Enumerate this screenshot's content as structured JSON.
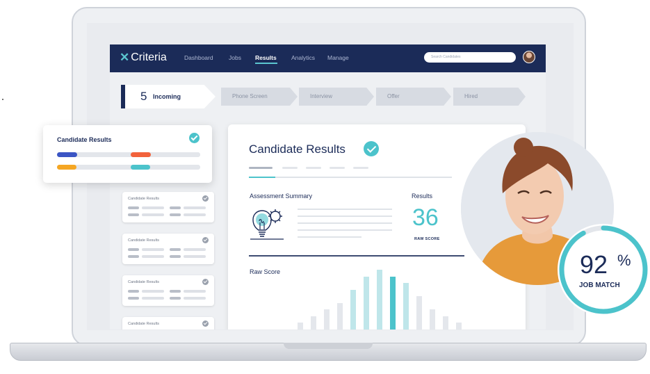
{
  "nav": {
    "logo": "Criteria",
    "items": [
      "Dashboard",
      "Jobs",
      "Results",
      "Analytics",
      "Manage"
    ],
    "active_index": 2,
    "search_placeholder": "Search Candidates"
  },
  "pipeline": {
    "current": {
      "count": "5",
      "label": "Incoming"
    },
    "stages": [
      "Phone Screen",
      "Interview",
      "Offer",
      "Hired"
    ]
  },
  "candidate_list": {
    "item_title": "Candidate Results",
    "items": [
      "Candidate Results",
      "Candidate Results",
      "Candidate Results",
      "Candidate Results"
    ]
  },
  "float_card": {
    "title": "Candidate Results",
    "colors": [
      "#3b55c4",
      "#f2623b",
      "#f5a623",
      "#4cc3cb"
    ]
  },
  "results_panel": {
    "title": "Candidate Results",
    "assessment_label": "Assessment Summary",
    "results_label": "Results",
    "score": "36",
    "score_caption": "RAW SCORE",
    "raw_score_label": "Raw Score",
    "distribution": [
      1,
      2,
      3,
      4,
      6,
      8,
      9,
      8,
      7,
      5,
      3,
      2,
      1
    ],
    "highlight_index": 7,
    "accent": "#4cc3cb",
    "primary": "#1b2b58"
  },
  "job_match": {
    "value": "92",
    "unit": "%",
    "label": "JOB MATCH",
    "fraction": 0.92
  }
}
